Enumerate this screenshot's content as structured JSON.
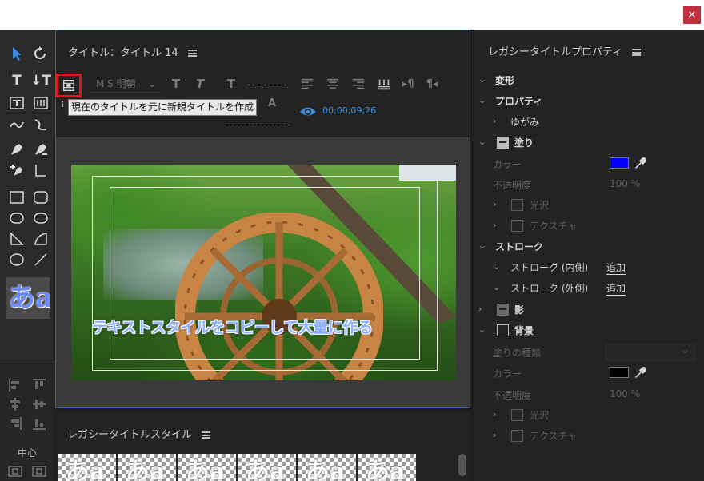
{
  "window": {
    "close_label": "×"
  },
  "tools": {
    "style_preview_text": "あa",
    "align_label": "中心"
  },
  "center": {
    "title": "タイトル：タイトル 14",
    "font_family": "M S 明朝",
    "tooltip": "現在のタイトルを元に新規タイトルを作成",
    "timecode": "00;00;09;26",
    "caption": "テキストスタイルをコピーして大量に作る"
  },
  "styles": {
    "title": "レガシータイトルスタイル",
    "swatches": [
      "あa",
      "あa",
      "あa",
      "あa",
      "あa",
      "あa"
    ]
  },
  "properties": {
    "title": "レガシータイトルプロパティ",
    "transform": "変形",
    "properties": "プロパティ",
    "distort": "ゆがみ",
    "fill": "塗り",
    "fill_color_label": "カラー",
    "fill_color": "#0000ff",
    "fill_opacity_label": "不透明度",
    "fill_opacity_value": "100 %",
    "sheen": "光沢",
    "texture": "テクスチャ",
    "stroke": "ストローク",
    "inner_stroke": "ストローク (内側)",
    "outer_stroke": "ストローク (外側)",
    "add": "追加",
    "shadow": "影",
    "background": "背景",
    "fill_type_label": "塗りの種類",
    "bg_color_label": "カラー",
    "bg_color": "#000000",
    "bg_opacity_label": "不透明度",
    "bg_opacity_value": "100 %",
    "bg_sheen": "光沢",
    "bg_texture": "テクスチャ"
  }
}
